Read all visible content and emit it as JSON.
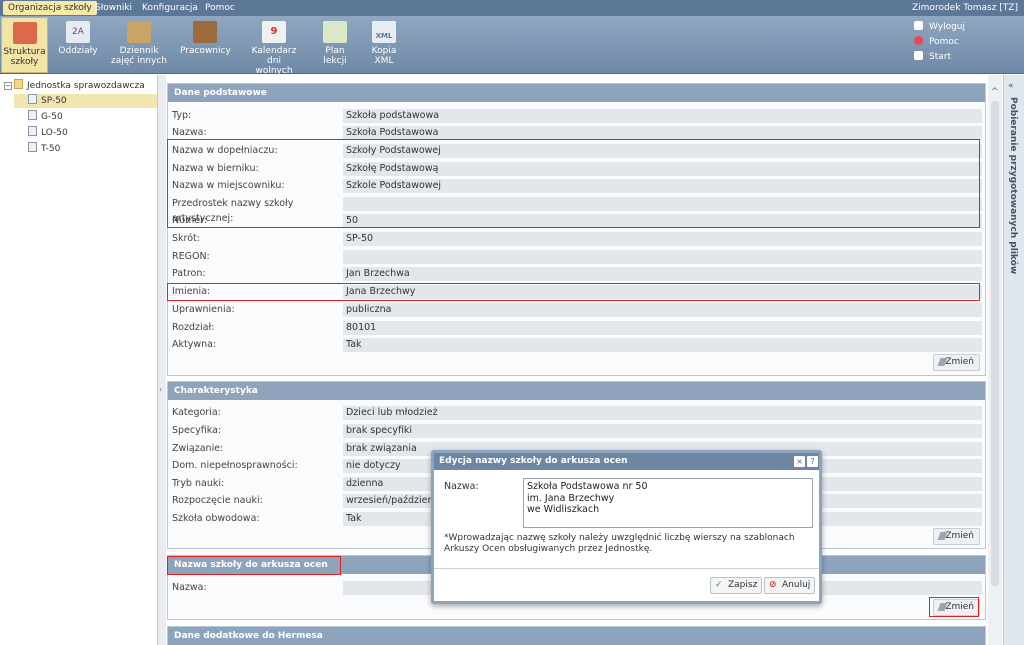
{
  "top_menu": {
    "items": [
      "Organizacja szkoły",
      "Słowniki",
      "Konfiguracja",
      "Pomoc"
    ],
    "user": "Zimorodek Tomasz [TZ]"
  },
  "toolbar": {
    "buttons": [
      {
        "label": "Struktura\nszkoły",
        "icon": "school-structure-icon"
      },
      {
        "label": "Oddziały",
        "icon": "classes-icon"
      },
      {
        "label": "Dziennik\nzajęć innych",
        "icon": "journal-icon"
      },
      {
        "label": "Pracownicy",
        "icon": "briefcase-icon"
      },
      {
        "label": "Kalendarz dni\nwolnych",
        "icon": "calendar-icon"
      },
      {
        "label": "Plan\nlekcji",
        "icon": "timetable-icon"
      },
      {
        "label": "Kopia\nXML",
        "icon": "xml-file-icon"
      }
    ],
    "links": {
      "logout": "Wyloguj",
      "help": "Pomoc",
      "start": "Start"
    }
  },
  "tree": {
    "root": "Jednostka sprawozdawcza",
    "items": [
      "SP-50",
      "G-50",
      "LO-50",
      "T-50"
    ]
  },
  "side_panel": {
    "label": "Pobieranie przygotowanych plików"
  },
  "basic_data": {
    "title": "Dane podstawowe",
    "rows": [
      {
        "label": "Typ:",
        "value": "Szkoła podstawowa"
      },
      {
        "label": "Nazwa:",
        "value": "Szkoła Podstawowa"
      },
      {
        "label": "Nazwa w dopełniaczu:",
        "value": "Szkoły Podstawowej"
      },
      {
        "label": "Nazwa w bierniku:",
        "value": "Szkołę Podstawową"
      },
      {
        "label": "Nazwa w miejscowniku:",
        "value": "Szkole Podstawowej"
      },
      {
        "label": "Przedrostek nazwy szkoły artystycznej:",
        "value": ""
      },
      {
        "label": "Numer:",
        "value": "50"
      },
      {
        "label": "Skrót:",
        "value": "SP-50"
      },
      {
        "label": "REGON:",
        "value": ""
      },
      {
        "label": "Patron:",
        "value": "Jan Brzechwa"
      },
      {
        "label": "Imienia:",
        "value": "Jana Brzechwy"
      },
      {
        "label": "Uprawnienia:",
        "value": "publiczna"
      },
      {
        "label": "Rozdział:",
        "value": "80101"
      },
      {
        "label": "Aktywna:",
        "value": "Tak"
      }
    ],
    "change": "Zmień"
  },
  "characteristics": {
    "title": "Charakterystyka",
    "rows": [
      {
        "label": "Kategoria:",
        "value": "Dzieci lub młodzież"
      },
      {
        "label": "Specyfika:",
        "value": "brak specyfiki"
      },
      {
        "label": "Związanie:",
        "value": "brak związania"
      },
      {
        "label": "Dom. niepełnosprawności:",
        "value": "nie dotyczy"
      },
      {
        "label": "Tryb nauki:",
        "value": "dzienna"
      },
      {
        "label": "Rozpoczęcie nauki:",
        "value": "wrzesień/październik"
      },
      {
        "label": "Szkoła obwodowa:",
        "value": "Tak"
      }
    ],
    "change": "Zmień"
  },
  "report_name": {
    "title": "Nazwa szkoły do arkusza ocen",
    "rows": [
      {
        "label": "Nazwa:",
        "value": ""
      }
    ],
    "change": "Zmień"
  },
  "hermes": {
    "title": "Dane dodatkowe do Hermesa"
  },
  "dialog": {
    "title": "Edycja nazwy szkoły do arkusza ocen",
    "close": "×",
    "help": "?",
    "name_label": "Nazwa:",
    "name_value": "Szkoła Podstawowa nr 50\nim. Jana Brzechwy\nwe Widliszkach",
    "note": "*Wprowadzając nazwę szkoły należy uwzględnić liczbę wierszy na szablonach Arkuszy Ocen obsługiwanych przez Jednostkę.",
    "save": "Zapisz",
    "cancel": "Anuluj"
  }
}
